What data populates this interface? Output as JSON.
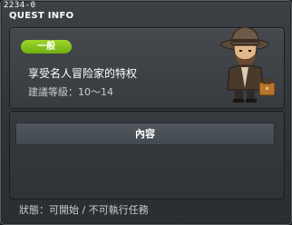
{
  "header": {
    "quest_id": "2234-0",
    "title": "QUEST INFO"
  },
  "quest": {
    "category_badge": "一般",
    "name": "享受名人冒险家的特权",
    "level_requirement": "建議等級：10～14",
    "npc_portrait": "adventurer-npc-with-fedora-and-briefcase"
  },
  "content_section": {
    "tab_label": "內容"
  },
  "status": "狀態：可開始 / 不可執行任務",
  "colors": {
    "badge": "#8cc61e",
    "panel": "#3f4347",
    "background": "#2f3236"
  }
}
